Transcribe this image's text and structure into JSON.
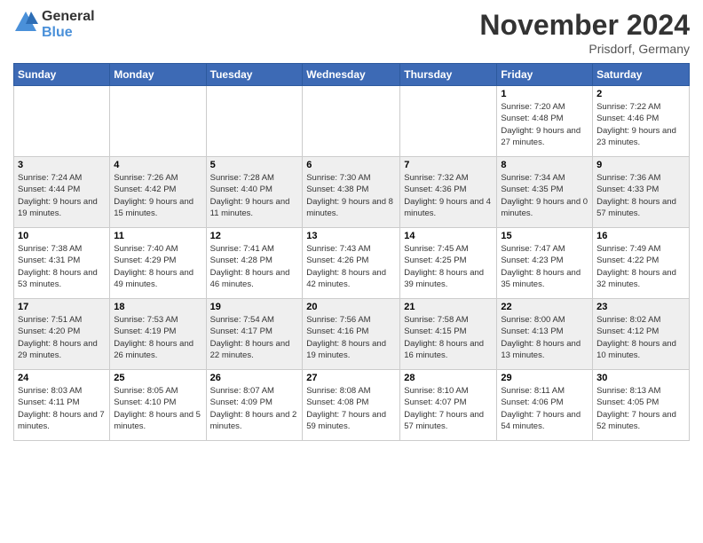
{
  "header": {
    "logo_general": "General",
    "logo_blue": "Blue",
    "month_title": "November 2024",
    "location": "Prisdorf, Germany"
  },
  "days_of_week": [
    "Sunday",
    "Monday",
    "Tuesday",
    "Wednesday",
    "Thursday",
    "Friday",
    "Saturday"
  ],
  "weeks": [
    [
      {
        "day": "",
        "sunrise": "",
        "sunset": "",
        "daylight": ""
      },
      {
        "day": "",
        "sunrise": "",
        "sunset": "",
        "daylight": ""
      },
      {
        "day": "",
        "sunrise": "",
        "sunset": "",
        "daylight": ""
      },
      {
        "day": "",
        "sunrise": "",
        "sunset": "",
        "daylight": ""
      },
      {
        "day": "",
        "sunrise": "",
        "sunset": "",
        "daylight": ""
      },
      {
        "day": "1",
        "sunrise": "Sunrise: 7:20 AM",
        "sunset": "Sunset: 4:48 PM",
        "daylight": "Daylight: 9 hours and 27 minutes."
      },
      {
        "day": "2",
        "sunrise": "Sunrise: 7:22 AM",
        "sunset": "Sunset: 4:46 PM",
        "daylight": "Daylight: 9 hours and 23 minutes."
      }
    ],
    [
      {
        "day": "3",
        "sunrise": "Sunrise: 7:24 AM",
        "sunset": "Sunset: 4:44 PM",
        "daylight": "Daylight: 9 hours and 19 minutes."
      },
      {
        "day": "4",
        "sunrise": "Sunrise: 7:26 AM",
        "sunset": "Sunset: 4:42 PM",
        "daylight": "Daylight: 9 hours and 15 minutes."
      },
      {
        "day": "5",
        "sunrise": "Sunrise: 7:28 AM",
        "sunset": "Sunset: 4:40 PM",
        "daylight": "Daylight: 9 hours and 11 minutes."
      },
      {
        "day": "6",
        "sunrise": "Sunrise: 7:30 AM",
        "sunset": "Sunset: 4:38 PM",
        "daylight": "Daylight: 9 hours and 8 minutes."
      },
      {
        "day": "7",
        "sunrise": "Sunrise: 7:32 AM",
        "sunset": "Sunset: 4:36 PM",
        "daylight": "Daylight: 9 hours and 4 minutes."
      },
      {
        "day": "8",
        "sunrise": "Sunrise: 7:34 AM",
        "sunset": "Sunset: 4:35 PM",
        "daylight": "Daylight: 9 hours and 0 minutes."
      },
      {
        "day": "9",
        "sunrise": "Sunrise: 7:36 AM",
        "sunset": "Sunset: 4:33 PM",
        "daylight": "Daylight: 8 hours and 57 minutes."
      }
    ],
    [
      {
        "day": "10",
        "sunrise": "Sunrise: 7:38 AM",
        "sunset": "Sunset: 4:31 PM",
        "daylight": "Daylight: 8 hours and 53 minutes."
      },
      {
        "day": "11",
        "sunrise": "Sunrise: 7:40 AM",
        "sunset": "Sunset: 4:29 PM",
        "daylight": "Daylight: 8 hours and 49 minutes."
      },
      {
        "day": "12",
        "sunrise": "Sunrise: 7:41 AM",
        "sunset": "Sunset: 4:28 PM",
        "daylight": "Daylight: 8 hours and 46 minutes."
      },
      {
        "day": "13",
        "sunrise": "Sunrise: 7:43 AM",
        "sunset": "Sunset: 4:26 PM",
        "daylight": "Daylight: 8 hours and 42 minutes."
      },
      {
        "day": "14",
        "sunrise": "Sunrise: 7:45 AM",
        "sunset": "Sunset: 4:25 PM",
        "daylight": "Daylight: 8 hours and 39 minutes."
      },
      {
        "day": "15",
        "sunrise": "Sunrise: 7:47 AM",
        "sunset": "Sunset: 4:23 PM",
        "daylight": "Daylight: 8 hours and 35 minutes."
      },
      {
        "day": "16",
        "sunrise": "Sunrise: 7:49 AM",
        "sunset": "Sunset: 4:22 PM",
        "daylight": "Daylight: 8 hours and 32 minutes."
      }
    ],
    [
      {
        "day": "17",
        "sunrise": "Sunrise: 7:51 AM",
        "sunset": "Sunset: 4:20 PM",
        "daylight": "Daylight: 8 hours and 29 minutes."
      },
      {
        "day": "18",
        "sunrise": "Sunrise: 7:53 AM",
        "sunset": "Sunset: 4:19 PM",
        "daylight": "Daylight: 8 hours and 26 minutes."
      },
      {
        "day": "19",
        "sunrise": "Sunrise: 7:54 AM",
        "sunset": "Sunset: 4:17 PM",
        "daylight": "Daylight: 8 hours and 22 minutes."
      },
      {
        "day": "20",
        "sunrise": "Sunrise: 7:56 AM",
        "sunset": "Sunset: 4:16 PM",
        "daylight": "Daylight: 8 hours and 19 minutes."
      },
      {
        "day": "21",
        "sunrise": "Sunrise: 7:58 AM",
        "sunset": "Sunset: 4:15 PM",
        "daylight": "Daylight: 8 hours and 16 minutes."
      },
      {
        "day": "22",
        "sunrise": "Sunrise: 8:00 AM",
        "sunset": "Sunset: 4:13 PM",
        "daylight": "Daylight: 8 hours and 13 minutes."
      },
      {
        "day": "23",
        "sunrise": "Sunrise: 8:02 AM",
        "sunset": "Sunset: 4:12 PM",
        "daylight": "Daylight: 8 hours and 10 minutes."
      }
    ],
    [
      {
        "day": "24",
        "sunrise": "Sunrise: 8:03 AM",
        "sunset": "Sunset: 4:11 PM",
        "daylight": "Daylight: 8 hours and 7 minutes."
      },
      {
        "day": "25",
        "sunrise": "Sunrise: 8:05 AM",
        "sunset": "Sunset: 4:10 PM",
        "daylight": "Daylight: 8 hours and 5 minutes."
      },
      {
        "day": "26",
        "sunrise": "Sunrise: 8:07 AM",
        "sunset": "Sunset: 4:09 PM",
        "daylight": "Daylight: 8 hours and 2 minutes."
      },
      {
        "day": "27",
        "sunrise": "Sunrise: 8:08 AM",
        "sunset": "Sunset: 4:08 PM",
        "daylight": "Daylight: 7 hours and 59 minutes."
      },
      {
        "day": "28",
        "sunrise": "Sunrise: 8:10 AM",
        "sunset": "Sunset: 4:07 PM",
        "daylight": "Daylight: 7 hours and 57 minutes."
      },
      {
        "day": "29",
        "sunrise": "Sunrise: 8:11 AM",
        "sunset": "Sunset: 4:06 PM",
        "daylight": "Daylight: 7 hours and 54 minutes."
      },
      {
        "day": "30",
        "sunrise": "Sunrise: 8:13 AM",
        "sunset": "Sunset: 4:05 PM",
        "daylight": "Daylight: 7 hours and 52 minutes."
      }
    ]
  ]
}
